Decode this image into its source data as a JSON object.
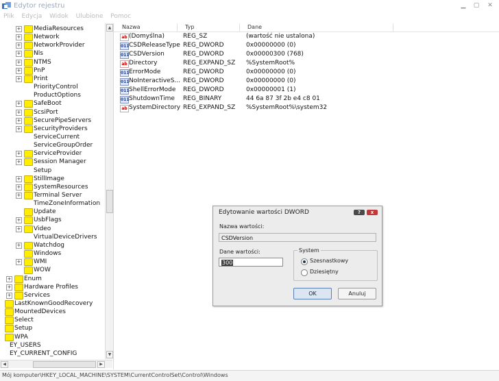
{
  "window": {
    "title": "Edytor rejestru"
  },
  "menu": [
    "Plik",
    "Edycja",
    "Widok",
    "Ulubione",
    "Pomoc"
  ],
  "tree": {
    "items": [
      {
        "label": "MediaResources",
        "expand": "+",
        "folder": true,
        "indent": 2
      },
      {
        "label": "Network",
        "expand": "+",
        "folder": true,
        "indent": 2
      },
      {
        "label": "NetworkProvider",
        "expand": "+",
        "folder": true,
        "indent": 2
      },
      {
        "label": "Nls",
        "expand": "+",
        "folder": true,
        "indent": 2
      },
      {
        "label": "NTMS",
        "expand": "+",
        "folder": true,
        "indent": 2
      },
      {
        "label": "PnP",
        "expand": "+",
        "folder": true,
        "indent": 2
      },
      {
        "label": "Print",
        "expand": "+",
        "folder": true,
        "indent": 2
      },
      {
        "label": "PriorityControl",
        "expand": "",
        "folder": false,
        "indent": 2
      },
      {
        "label": "ProductOptions",
        "expand": "",
        "folder": false,
        "indent": 2
      },
      {
        "label": "SafeBoot",
        "expand": "+",
        "folder": true,
        "indent": 2
      },
      {
        "label": "ScsiPort",
        "expand": "+",
        "folder": true,
        "indent": 2
      },
      {
        "label": "SecurePipeServers",
        "expand": "+",
        "folder": true,
        "indent": 2
      },
      {
        "label": "SecurityProviders",
        "expand": "+",
        "folder": true,
        "indent": 2
      },
      {
        "label": "ServiceCurrent",
        "expand": "",
        "folder": false,
        "indent": 2
      },
      {
        "label": "ServiceGroupOrder",
        "expand": "",
        "folder": false,
        "indent": 2
      },
      {
        "label": "ServiceProvider",
        "expand": "+",
        "folder": true,
        "indent": 2
      },
      {
        "label": "Session Manager",
        "expand": "+",
        "folder": true,
        "indent": 2
      },
      {
        "label": "Setup",
        "expand": "",
        "folder": false,
        "indent": 2
      },
      {
        "label": "StillImage",
        "expand": "+",
        "folder": true,
        "indent": 2
      },
      {
        "label": "SystemResources",
        "expand": "+",
        "folder": true,
        "indent": 2
      },
      {
        "label": "Terminal Server",
        "expand": "+",
        "folder": true,
        "indent": 2
      },
      {
        "label": "TimeZoneInformation",
        "expand": "",
        "folder": false,
        "indent": 2
      },
      {
        "label": "Update",
        "expand": "",
        "folder": true,
        "indent": 2
      },
      {
        "label": "UsbFlags",
        "expand": "+",
        "folder": true,
        "indent": 2
      },
      {
        "label": "Video",
        "expand": "+",
        "folder": true,
        "indent": 2
      },
      {
        "label": "VirtualDeviceDrivers",
        "expand": "",
        "folder": false,
        "indent": 2
      },
      {
        "label": "Watchdog",
        "expand": "+",
        "folder": true,
        "indent": 2
      },
      {
        "label": "Windows",
        "expand": "",
        "folder": true,
        "indent": 2
      },
      {
        "label": "WMI",
        "expand": "+",
        "folder": true,
        "indent": 2
      },
      {
        "label": "WOW",
        "expand": "",
        "folder": true,
        "indent": 2
      },
      {
        "label": "Enum",
        "expand": "+",
        "folder": true,
        "indent": 1
      },
      {
        "label": "Hardware Profiles",
        "expand": "+",
        "folder": true,
        "indent": 1
      },
      {
        "label": "Services",
        "expand": "+",
        "folder": true,
        "indent": 1
      },
      {
        "label": "LastKnownGoodRecovery",
        "expand": "",
        "folder": true,
        "indent": 0
      },
      {
        "label": "MountedDevices",
        "expand": "",
        "folder": true,
        "indent": 0
      },
      {
        "label": "Select",
        "expand": "",
        "folder": true,
        "indent": 0
      },
      {
        "label": "Setup",
        "expand": "",
        "folder": true,
        "indent": 0
      },
      {
        "label": "WPA",
        "expand": "",
        "folder": true,
        "indent": 0
      },
      {
        "label": "EY_USERS",
        "expand": "",
        "folder": false,
        "indent": -1
      },
      {
        "label": "EY_CURRENT_CONFIG",
        "expand": "",
        "folder": false,
        "indent": -1
      }
    ]
  },
  "list": {
    "headers": [
      "Nazwa",
      "Typ",
      "Dane"
    ],
    "rows": [
      {
        "icon": "ab",
        "name": "(Domyślna)",
        "type": "REG_SZ",
        "data": "(wartość nie ustalona)"
      },
      {
        "icon": "bin",
        "name": "CSDReleaseType",
        "type": "REG_DWORD",
        "data": "0x00000000 (0)"
      },
      {
        "icon": "bin",
        "name": "CSDVersion",
        "type": "REG_DWORD",
        "data": "0x00000300 (768)"
      },
      {
        "icon": "ab",
        "name": "Directory",
        "type": "REG_EXPAND_SZ",
        "data": "%SystemRoot%"
      },
      {
        "icon": "bin",
        "name": "ErrorMode",
        "type": "REG_DWORD",
        "data": "0x00000000 (0)"
      },
      {
        "icon": "bin",
        "name": "NoInteractiveS...",
        "type": "REG_DWORD",
        "data": "0x00000000 (0)"
      },
      {
        "icon": "bin",
        "name": "ShellErrorMode",
        "type": "REG_DWORD",
        "data": "0x00000001 (1)"
      },
      {
        "icon": "bin",
        "name": "ShutdownTime",
        "type": "REG_BINARY",
        "data": "44 6a 87 3f 2b e4 c8 01"
      },
      {
        "icon": "ab",
        "name": "SystemDirectory",
        "type": "REG_EXPAND_SZ",
        "data": "%SystemRoot%\\system32"
      }
    ]
  },
  "status": {
    "text": "Mój komputer\\HKEY_LOCAL_MACHINE\\SYSTEM\\CurrentControlSet\\Control\\Windows"
  },
  "dialog": {
    "title": "Edytowanie wartości DWORD",
    "help_label": "?",
    "close_label": "x",
    "name_label": "Nazwa wartości:",
    "name_value": "CSDVersion",
    "data_label": "Dane wartości:",
    "data_value": "300",
    "system_label": "System",
    "radio_hex": "Szesnastkowy",
    "radio_dec": "Dziesiętny",
    "selected": "hex",
    "ok_label": "OK",
    "cancel_label": "Anuluj"
  }
}
